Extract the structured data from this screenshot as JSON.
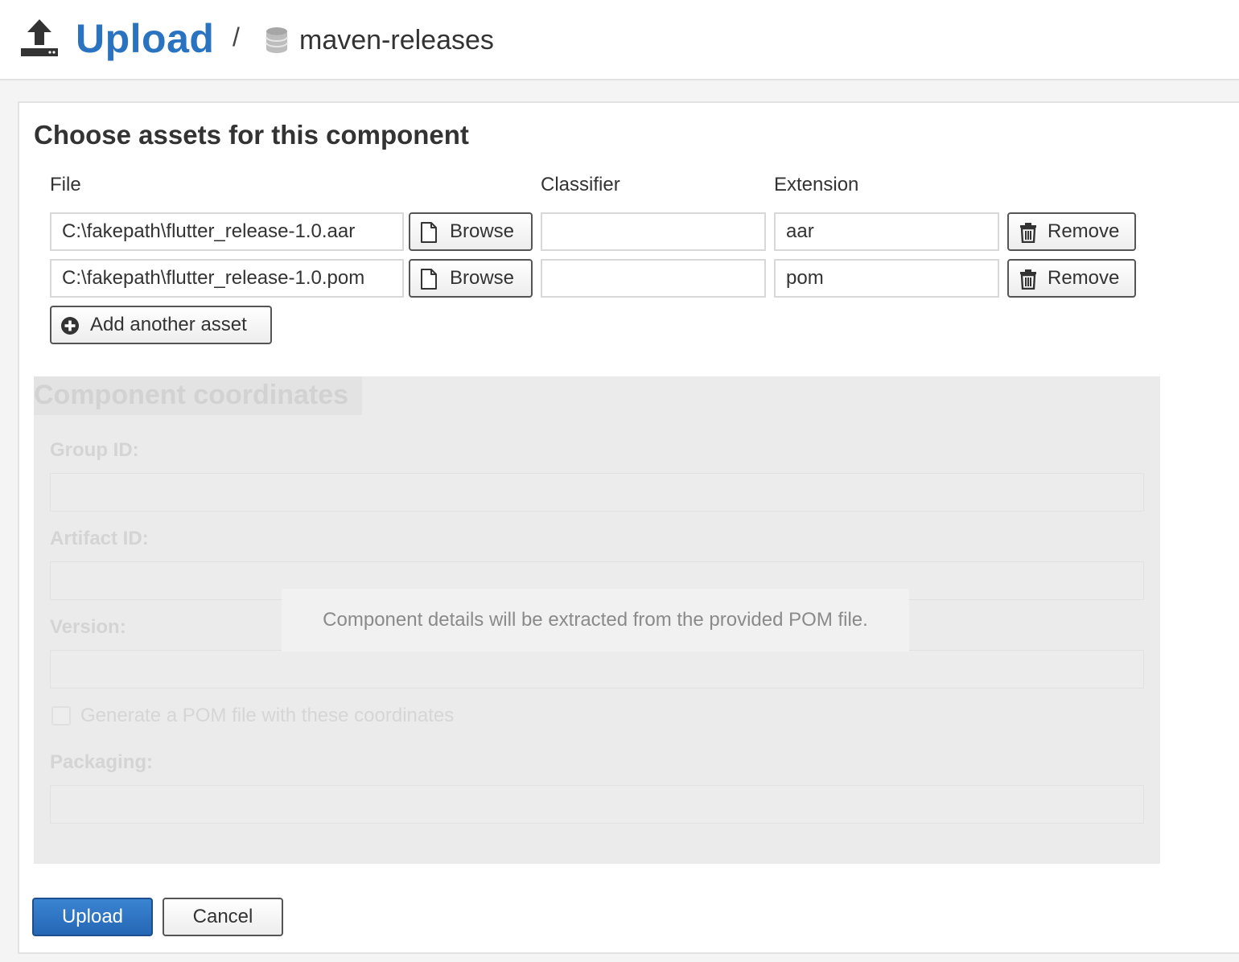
{
  "header": {
    "icon": "upload-icon",
    "title": "Upload",
    "separator": "/",
    "repo_icon": "database-icon",
    "repo_name": "maven-releases"
  },
  "assets": {
    "title": "Choose assets for this component",
    "columns": {
      "file": "File",
      "classifier": "Classifier",
      "extension": "Extension"
    },
    "rows": [
      {
        "file": "C:\\fakepath\\flutter_release-1.0.aar",
        "browse_label": "Browse",
        "classifier": "",
        "extension": "aar",
        "remove_label": "Remove"
      },
      {
        "file": "C:\\fakepath\\flutter_release-1.0.pom",
        "browse_label": "Browse",
        "classifier": "",
        "extension": "pom",
        "remove_label": "Remove"
      }
    ],
    "add_label": "Add another asset"
  },
  "coordinates": {
    "title": "Component coordinates",
    "group_id_label": "Group ID:",
    "group_id_value": "",
    "artifact_id_label": "Artifact ID:",
    "artifact_id_value": "",
    "version_label": "Version:",
    "version_value": "",
    "generate_pom_label": "Generate a POM file with these coordinates",
    "generate_pom_checked": false,
    "packaging_label": "Packaging:",
    "packaging_value": "",
    "overlay_message": "Component details will be extracted from the provided POM file."
  },
  "actions": {
    "upload_label": "Upload",
    "cancel_label": "Cancel"
  },
  "colors": {
    "brand_blue": "#2a73c0",
    "primary_button": "#2567b5",
    "disabled_bg": "#ebebeb"
  }
}
